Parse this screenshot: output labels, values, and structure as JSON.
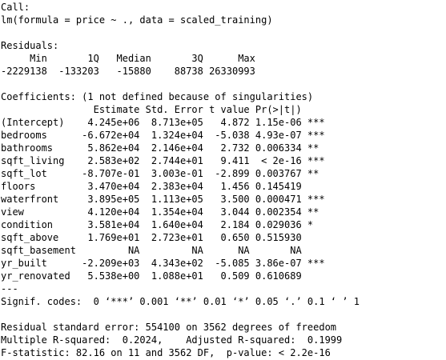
{
  "call": {
    "header": "Call:",
    "formula": "lm(formula = price ~ ., data = scaled_training)"
  },
  "residuals": {
    "header": "Residuals:",
    "labels": "     Min       1Q   Median       3Q      Max ",
    "values": "-2229138  -133203   -15880    88738 26330993 "
  },
  "coefficients": {
    "header": "Coefficients: (1 not defined because of singularities)",
    "columns": "                Estimate Std. Error t value Pr(>|t|)    ",
    "rows": [
      {
        "term": "(Intercept)",
        "line": "(Intercept)    4.245e+06  8.713e+05   4.872 1.15e-06 ***"
      },
      {
        "term": "bedrooms",
        "line": "bedrooms      -6.672e+04  1.324e+04  -5.038 4.93e-07 ***"
      },
      {
        "term": "bathrooms",
        "line": "bathrooms      5.862e+04  2.146e+04   2.732 0.006334 ** "
      },
      {
        "term": "sqft_living",
        "line": "sqft_living    2.583e+02  2.744e+01   9.411  < 2e-16 ***"
      },
      {
        "term": "sqft_lot",
        "line": "sqft_lot      -8.707e-01  3.003e-01  -2.899 0.003767 ** "
      },
      {
        "term": "floors",
        "line": "floors         3.470e+04  2.383e+04   1.456 0.145419    "
      },
      {
        "term": "waterfront",
        "line": "waterfront     3.895e+05  1.113e+05   3.500 0.000471 ***"
      },
      {
        "term": "view",
        "line": "view           4.120e+04  1.354e+04   3.044 0.002354 ** "
      },
      {
        "term": "condition",
        "line": "condition      3.581e+04  1.640e+04   2.184 0.029036 *  "
      },
      {
        "term": "sqft_above",
        "line": "sqft_above     1.769e+01  2.723e+01   0.650 0.515930    "
      },
      {
        "term": "sqft_basement",
        "line": "sqft_basement         NA         NA      NA       NA    "
      },
      {
        "term": "yr_built",
        "line": "yr_built      -2.209e+03  4.343e+02  -5.085 3.86e-07 ***"
      },
      {
        "term": "yr_renovated",
        "line": "yr_renovated   5.538e+00  1.088e+01   0.509 0.610689    "
      }
    ],
    "separator": "---",
    "signif_codes": "Signif. codes:  0 ‘***’ 0.001 ‘**’ 0.01 ‘*’ 0.05 ‘.’ 0.1 ‘ ’ 1"
  },
  "summary": {
    "rse": "Residual standard error: 554100 on 3562 degrees of freedom",
    "r_squared": "Multiple R-squared:  0.2024,\tAdjusted R-squared:  0.1999 ",
    "f_statistic": "F-statistic: 82.16 on 11 and 3562 DF,  p-value: < 2.2e-16"
  }
}
